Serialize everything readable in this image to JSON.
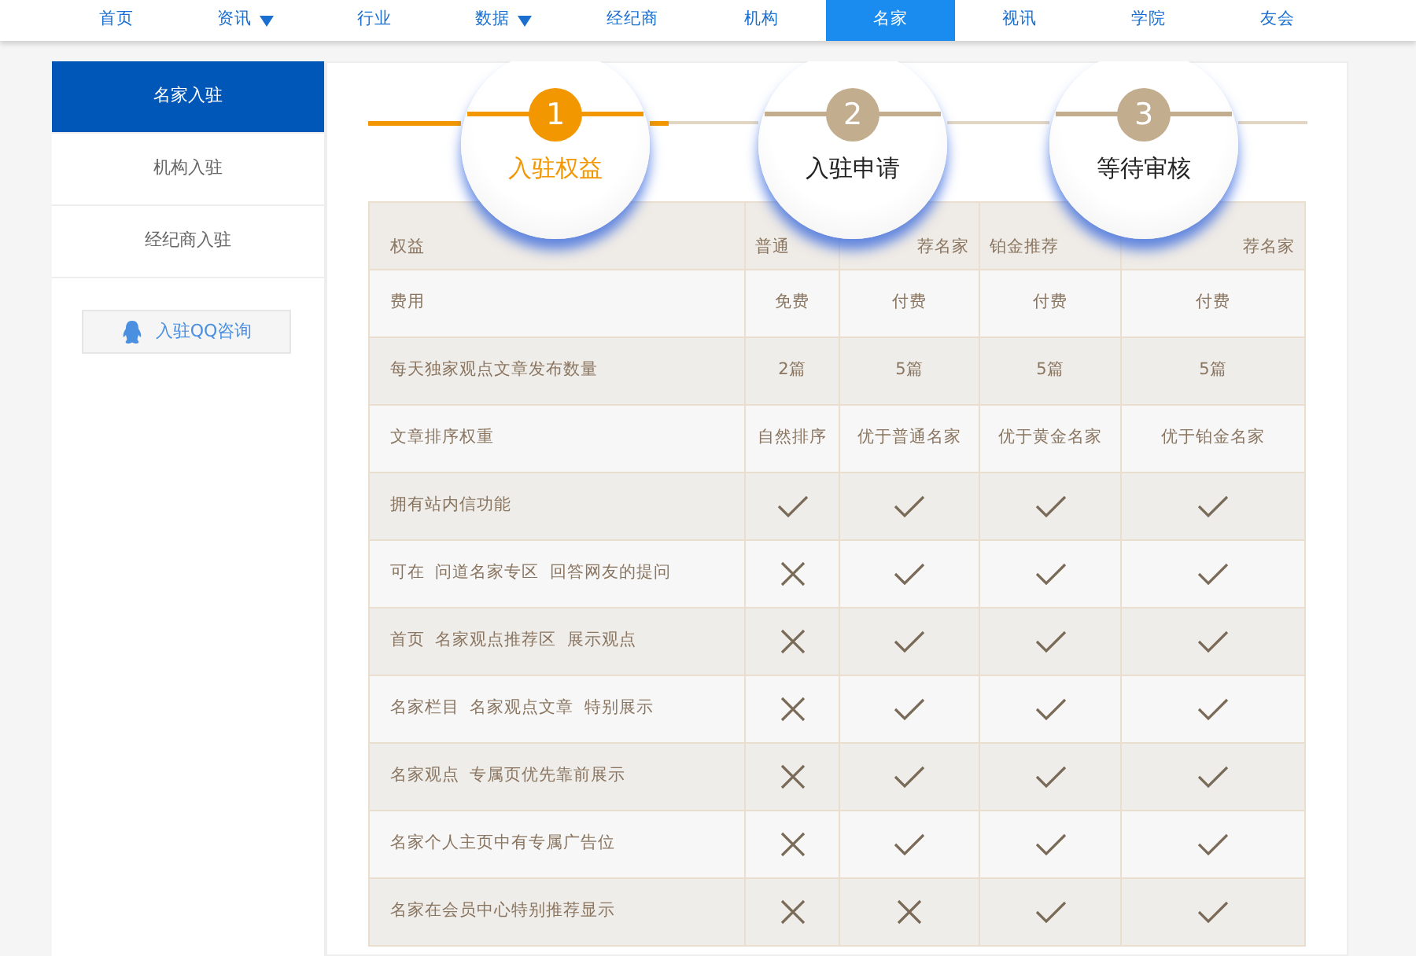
{
  "nav": [
    {
      "label": "首页",
      "dropdown": false,
      "selected": false
    },
    {
      "label": "资讯",
      "dropdown": true,
      "selected": false
    },
    {
      "label": "行业",
      "dropdown": false,
      "selected": false
    },
    {
      "label": "数据",
      "dropdown": true,
      "selected": false
    },
    {
      "label": "经纪商",
      "dropdown": false,
      "selected": false
    },
    {
      "label": "机构",
      "dropdown": false,
      "selected": false
    },
    {
      "label": "名家",
      "dropdown": false,
      "selected": true
    },
    {
      "label": "视讯",
      "dropdown": false,
      "selected": false
    },
    {
      "label": "学院",
      "dropdown": false,
      "selected": false
    },
    {
      "label": "友会",
      "dropdown": false,
      "selected": false
    }
  ],
  "sidebar": {
    "items": [
      {
        "label": "名家入驻",
        "selected": true
      },
      {
        "label": "机构入驻",
        "selected": false
      },
      {
        "label": "经纪商入驻",
        "selected": false
      }
    ],
    "qq_button": "入驻QQ咨询"
  },
  "steps": [
    {
      "number": "1",
      "label": "入驻权益",
      "selected": true
    },
    {
      "number": "2",
      "label": "入驻申请",
      "selected": false
    },
    {
      "number": "3",
      "label": "等待审核",
      "selected": false
    }
  ],
  "table": {
    "columns": [
      {
        "label": "权益"
      },
      {
        "label": "普通"
      },
      {
        "label": "荐名家"
      },
      {
        "label": "铂金推荐"
      },
      {
        "label": "荐名家"
      }
    ],
    "rows": [
      {
        "cells": [
          {
            "kind": "text",
            "text": "费用"
          },
          {
            "kind": "text",
            "text": "免费"
          },
          {
            "kind": "text",
            "text": "付费"
          },
          {
            "kind": "text",
            "text": "付费"
          },
          {
            "kind": "text",
            "text": "付费"
          }
        ]
      },
      {
        "cells": [
          {
            "kind": "text",
            "text": "每天独家观点文章发布数量"
          },
          {
            "kind": "text",
            "text": "2篇"
          },
          {
            "kind": "text",
            "text": "5篇"
          },
          {
            "kind": "text",
            "text": "5篇"
          },
          {
            "kind": "text",
            "text": "5篇"
          }
        ]
      },
      {
        "cells": [
          {
            "kind": "text",
            "text": "文章排序权重"
          },
          {
            "kind": "text",
            "text": "自然排序"
          },
          {
            "kind": "text",
            "text": "优于普通名家"
          },
          {
            "kind": "text",
            "text": "优于黄金名家"
          },
          {
            "kind": "text",
            "text": "优于铂金名家"
          }
        ]
      },
      {
        "cells": [
          {
            "kind": "text",
            "text": "拥有站内信功能"
          },
          {
            "kind": "check"
          },
          {
            "kind": "check"
          },
          {
            "kind": "check"
          },
          {
            "kind": "check"
          }
        ]
      },
      {
        "cells": [
          {
            "kind": "text",
            "text": "可在  问道名家专区  回答网友的提问"
          },
          {
            "kind": "cross"
          },
          {
            "kind": "check"
          },
          {
            "kind": "check"
          },
          {
            "kind": "check"
          }
        ]
      },
      {
        "cells": [
          {
            "kind": "text",
            "text": "首页  名家观点推荐区  展示观点"
          },
          {
            "kind": "cross"
          },
          {
            "kind": "check"
          },
          {
            "kind": "check"
          },
          {
            "kind": "check"
          }
        ]
      },
      {
        "cells": [
          {
            "kind": "text",
            "text": "名家栏目  名家观点文章  特别展示"
          },
          {
            "kind": "cross"
          },
          {
            "kind": "check"
          },
          {
            "kind": "check"
          },
          {
            "kind": "check"
          }
        ]
      },
      {
        "cells": [
          {
            "kind": "text",
            "text": "名家观点  专属页优先靠前展示"
          },
          {
            "kind": "cross"
          },
          {
            "kind": "check"
          },
          {
            "kind": "check"
          },
          {
            "kind": "check"
          }
        ]
      },
      {
        "cells": [
          {
            "kind": "text",
            "text": "名家个人主页中有专属广告位"
          },
          {
            "kind": "cross"
          },
          {
            "kind": "check"
          },
          {
            "kind": "check"
          },
          {
            "kind": "check"
          }
        ]
      },
      {
        "cells": [
          {
            "kind": "text",
            "text": "名家在会员中心特别推荐显示"
          },
          {
            "kind": "cross"
          },
          {
            "kind": "cross"
          },
          {
            "kind": "check"
          },
          {
            "kind": "check"
          }
        ]
      }
    ]
  }
}
